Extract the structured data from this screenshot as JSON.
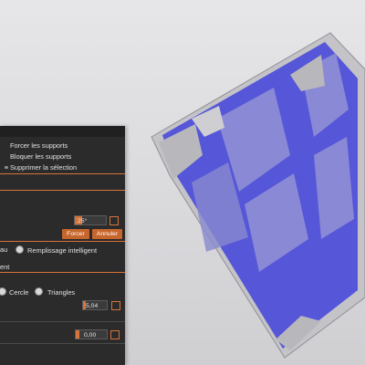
{
  "context_menu": {
    "items": [
      {
        "label": "Forcer les supports"
      },
      {
        "label": "Bloquer les supports"
      },
      {
        "label": "Supprimer la sélection"
      }
    ]
  },
  "angle_field": {
    "value": "25°"
  },
  "buttons": {
    "force_label": "Forcer",
    "cancel_label": "Annuler"
  },
  "fill_options": {
    "truncated_label": "au",
    "smart_fill_label": "Remplissage intelligent"
  },
  "truncated_label_2": "ent",
  "shape_options": {
    "circle_label": "Cercle",
    "triangles_label": "Triangles"
  },
  "value_field_1": {
    "value": "5,04"
  },
  "value_field_2": {
    "value": "0,00"
  },
  "colors": {
    "accent": "#d6743a",
    "model_highlight": "#5656d8",
    "model_face": "#9696d6",
    "panel_bg": "#2b2b2b"
  }
}
